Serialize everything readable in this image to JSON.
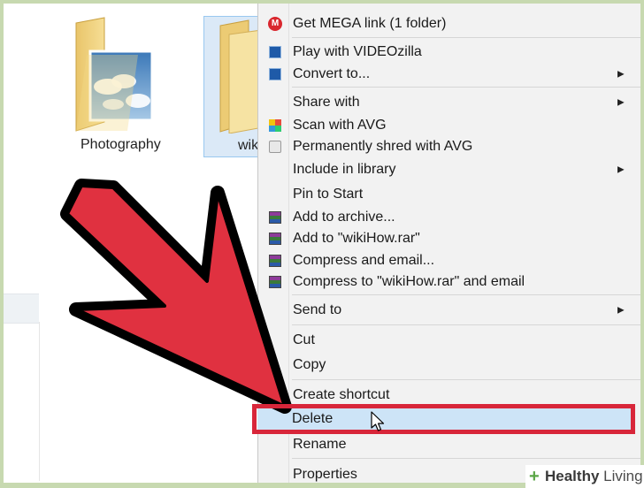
{
  "explorer": {
    "folders": [
      {
        "label": "Photography"
      },
      {
        "label": "wiki"
      }
    ]
  },
  "context_menu": {
    "items": [
      {
        "label": "Get MEGA link (1 folder)",
        "icon": "mega-icon"
      },
      {
        "label": "Play with VIDEOzilla",
        "icon": "videozilla-icon"
      },
      {
        "label": "Convert to...",
        "icon": "videozilla-icon",
        "submenu": true
      },
      {
        "label": "Share with",
        "submenu": true
      },
      {
        "label": "Scan with AVG",
        "icon": "avg-icon"
      },
      {
        "label": "Permanently shred with AVG",
        "icon": "shred-icon"
      },
      {
        "label": "Include in library",
        "submenu": true
      },
      {
        "label": "Pin to Start"
      },
      {
        "label": "Add to archive...",
        "icon": "winrar-icon"
      },
      {
        "label": "Add to \"wikiHow.rar\"",
        "icon": "winrar-icon"
      },
      {
        "label": "Compress and email...",
        "icon": "winrar-icon"
      },
      {
        "label": "Compress to \"wikiHow.rar\" and email",
        "icon": "winrar-icon"
      },
      {
        "label": "Send to",
        "submenu": true
      },
      {
        "label": "Cut"
      },
      {
        "label": "Copy"
      },
      {
        "label": "Create shortcut"
      },
      {
        "label": "Delete",
        "highlighted": true
      },
      {
        "label": "Rename"
      },
      {
        "label": "Properties"
      }
    ]
  },
  "submenu_arrow": "▶",
  "watermark": {
    "plus": "+",
    "brand_bold": "Healthy",
    "brand_rest": " Living"
  },
  "colors": {
    "highlight_box": "#d8263a",
    "arrow_fill": "#e03140",
    "menu_bg": "#f2f2f2",
    "selection": "#cde4f7",
    "frame": "#c7d9b0"
  }
}
